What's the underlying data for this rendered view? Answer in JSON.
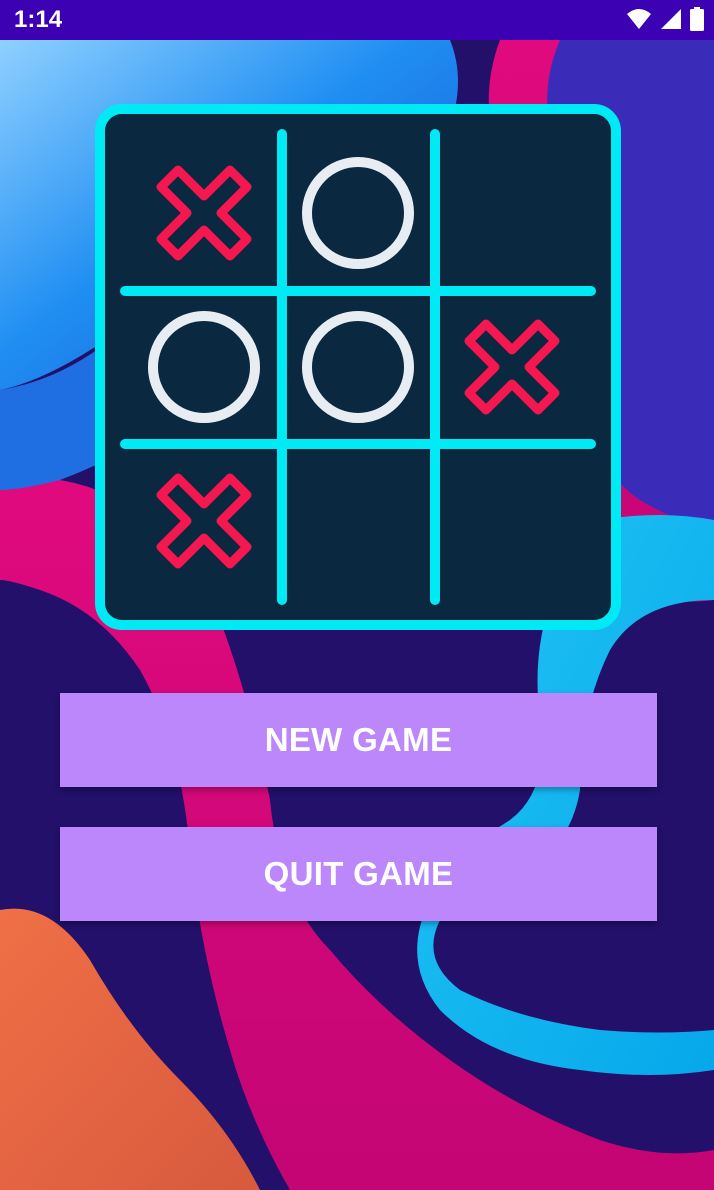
{
  "status_bar": {
    "time": "1:14",
    "icons": [
      "wifi-icon",
      "signal-icon",
      "battery-icon"
    ]
  },
  "board": {
    "cells": [
      [
        "X",
        "O",
        ""
      ],
      [
        "O",
        "O",
        "X"
      ],
      [
        "X",
        "",
        ""
      ]
    ],
    "colors": {
      "frame": "#00eaf5",
      "background": "#0a2840",
      "x": "#f5174f",
      "o": "#e8edf3"
    }
  },
  "buttons": {
    "new_game": "NEW GAME",
    "quit_game": "QUIT GAME",
    "color": "#bb87fb"
  },
  "background_colors": [
    "#1f0f66",
    "#d8067e",
    "#1e88f0",
    "#00b0f0",
    "#ec6a45",
    "#3a2bb5"
  ]
}
